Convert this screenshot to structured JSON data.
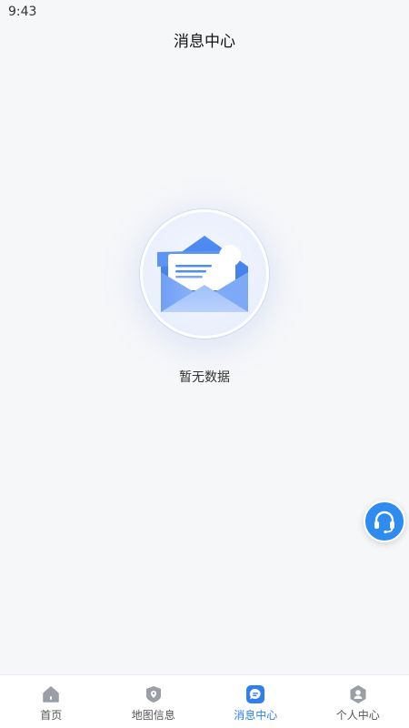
{
  "status_bar": {
    "time": "9:43"
  },
  "header": {
    "title": "消息中心"
  },
  "empty_state": {
    "text": "暂无数据",
    "icon": "open-envelope-icon"
  },
  "float_button": {
    "icon": "headset-icon",
    "color": "#2e8bf0"
  },
  "tab_bar": {
    "active_color": "#2f7ff0",
    "inactive_color": "#9a9ea6",
    "items": [
      {
        "label": "首页",
        "icon": "home-icon",
        "active": false
      },
      {
        "label": "地图信息",
        "icon": "map-pin-icon",
        "active": false
      },
      {
        "label": "消息中心",
        "icon": "message-icon",
        "active": true
      },
      {
        "label": "个人中心",
        "icon": "user-icon",
        "active": false
      }
    ]
  }
}
